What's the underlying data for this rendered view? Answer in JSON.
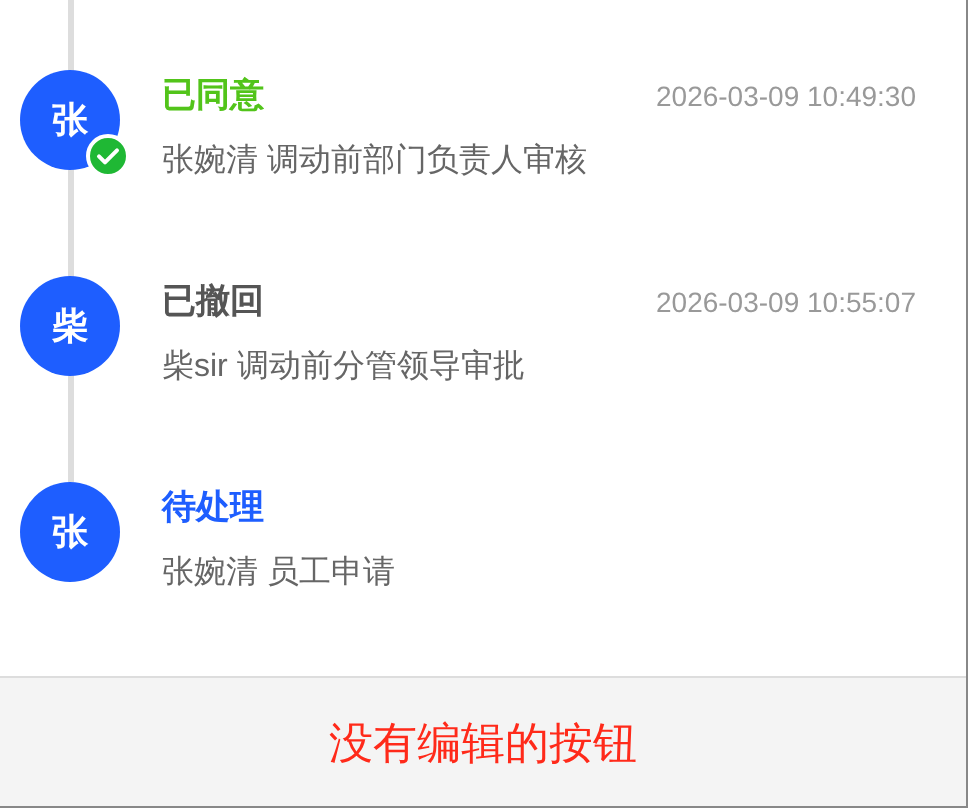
{
  "timeline": [
    {
      "avatar": "张",
      "status": "已同意",
      "kind": "approved",
      "time": "2026-03-09 10:49:30",
      "description": "张婉清 调动前部门负责人审核",
      "done": true
    },
    {
      "avatar": "柴",
      "status": "已撤回",
      "kind": "withdrawn",
      "time": "2026-03-09 10:55:07",
      "description": "柴sir 调动前分管领导审批",
      "done": false
    },
    {
      "avatar": "张",
      "status": "待处理",
      "kind": "pending",
      "description": "张婉清 员工申请",
      "done": false
    }
  ],
  "footer": {
    "message": "没有编辑的按钮"
  }
}
